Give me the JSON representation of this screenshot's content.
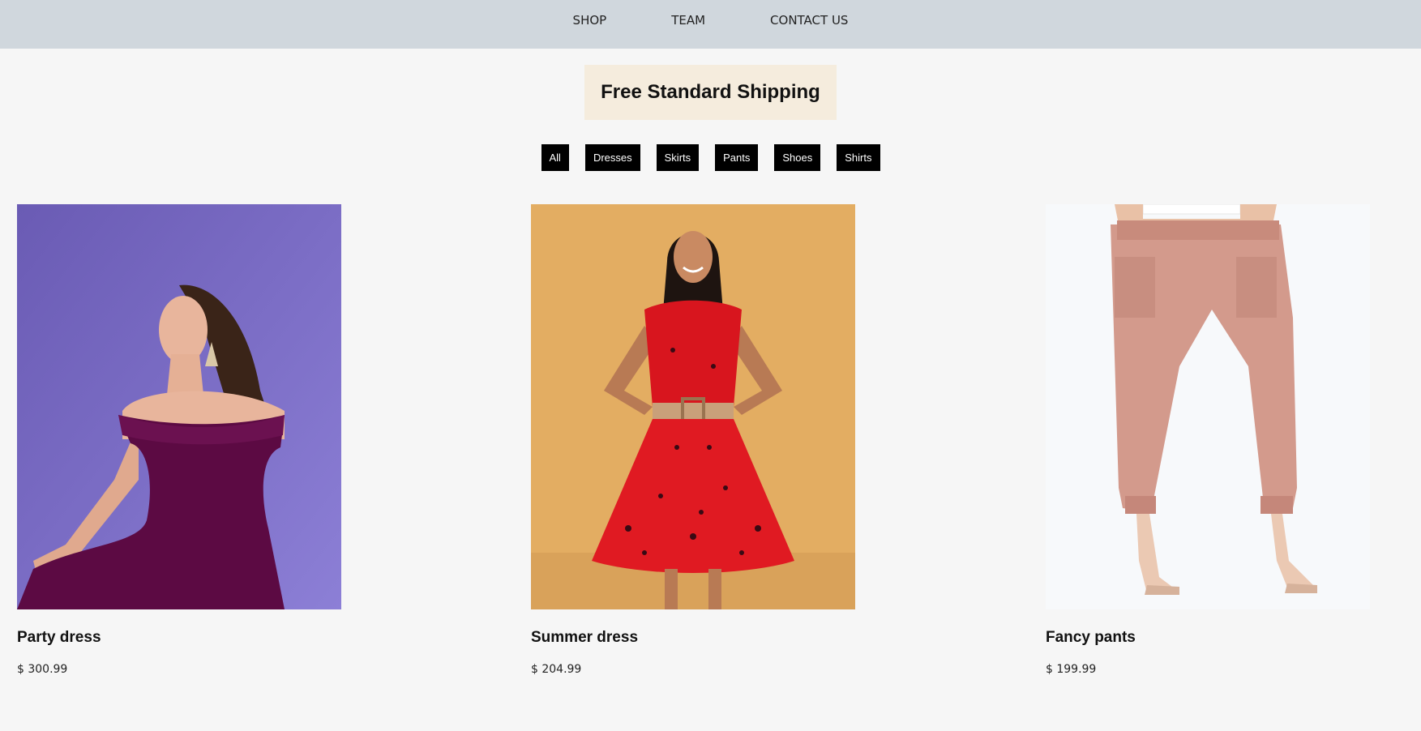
{
  "nav": {
    "items": [
      {
        "label": "SHOP"
      },
      {
        "label": "TEAM"
      },
      {
        "label": "CONTACT US"
      }
    ]
  },
  "banner": {
    "text": "Free Standard Shipping"
  },
  "filters": [
    {
      "label": "All"
    },
    {
      "label": "Dresses"
    },
    {
      "label": "Skirts"
    },
    {
      "label": "Pants"
    },
    {
      "label": "Shoes"
    },
    {
      "label": "Shirts"
    }
  ],
  "products": [
    {
      "name": "Party dress",
      "price": "$ 300.99",
      "image": "woman-purple-dress-photo",
      "bg_color": "#7d6fc7"
    },
    {
      "name": "Summer dress",
      "price": "$ 204.99",
      "image": "woman-red-floral-dress-photo",
      "bg_color": "#e3ad62"
    },
    {
      "name": "Fancy pants",
      "price": "$ 199.99",
      "image": "pink-pants-heels-photo",
      "bg_color": "#f7f9fb"
    }
  ]
}
